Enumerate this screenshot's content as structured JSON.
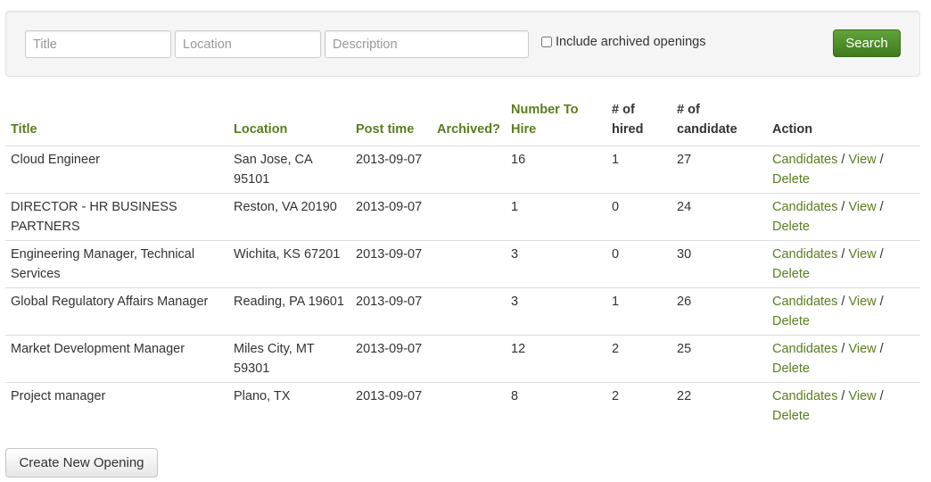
{
  "search": {
    "title_placeholder": "Title",
    "location_placeholder": "Location",
    "description_placeholder": "Description",
    "include_archived_label": "Include archived openings",
    "include_archived_checked": false,
    "search_button": "Search"
  },
  "table": {
    "columns": [
      {
        "key": "title",
        "label": "Title"
      },
      {
        "key": "location",
        "label": "Location"
      },
      {
        "key": "post_time",
        "label": "Post time"
      },
      {
        "key": "archived",
        "label": "Archived?"
      },
      {
        "key": "number_to_hire",
        "label": "Number To Hire"
      },
      {
        "key": "hired",
        "label": "# of hired"
      },
      {
        "key": "candidates",
        "label": "# of candidate"
      },
      {
        "key": "action",
        "label": "Action"
      }
    ],
    "actions": {
      "candidates": "Candidates",
      "view": "View",
      "delete": "Delete",
      "separator": "/"
    },
    "rows": [
      {
        "title": "Cloud Engineer",
        "location": "San Jose, CA 95101",
        "post_time": "2013-09-07",
        "archived": "",
        "number_to_hire": "16",
        "hired": "1",
        "candidates": "27"
      },
      {
        "title": "DIRECTOR - HR BUSINESS PARTNERS",
        "location": "Reston, VA 20190",
        "post_time": "2013-09-07",
        "archived": "",
        "number_to_hire": "1",
        "hired": "0",
        "candidates": "24"
      },
      {
        "title": "Engineering Manager, Technical Services",
        "location": "Wichita, KS 67201",
        "post_time": "2013-09-07",
        "archived": "",
        "number_to_hire": "3",
        "hired": "0",
        "candidates": "30"
      },
      {
        "title": "Global Regulatory Affairs Manager",
        "location": "Reading, PA 19601",
        "post_time": "2013-09-07",
        "archived": "",
        "number_to_hire": "3",
        "hired": "1",
        "candidates": "26"
      },
      {
        "title": "Market Development Manager",
        "location": "Miles City, MT 59301",
        "post_time": "2013-09-07",
        "archived": "",
        "number_to_hire": "12",
        "hired": "2",
        "candidates": "25"
      },
      {
        "title": "Project manager",
        "location": "Plano, TX",
        "post_time": "2013-09-07",
        "archived": "",
        "number_to_hire": "8",
        "hired": "2",
        "candidates": "22"
      }
    ]
  },
  "footer": {
    "create_button": "Create New Opening"
  },
  "colors": {
    "accent": "#5a7d1e",
    "primary_button": "#4a8a22",
    "border": "#dddddd"
  }
}
